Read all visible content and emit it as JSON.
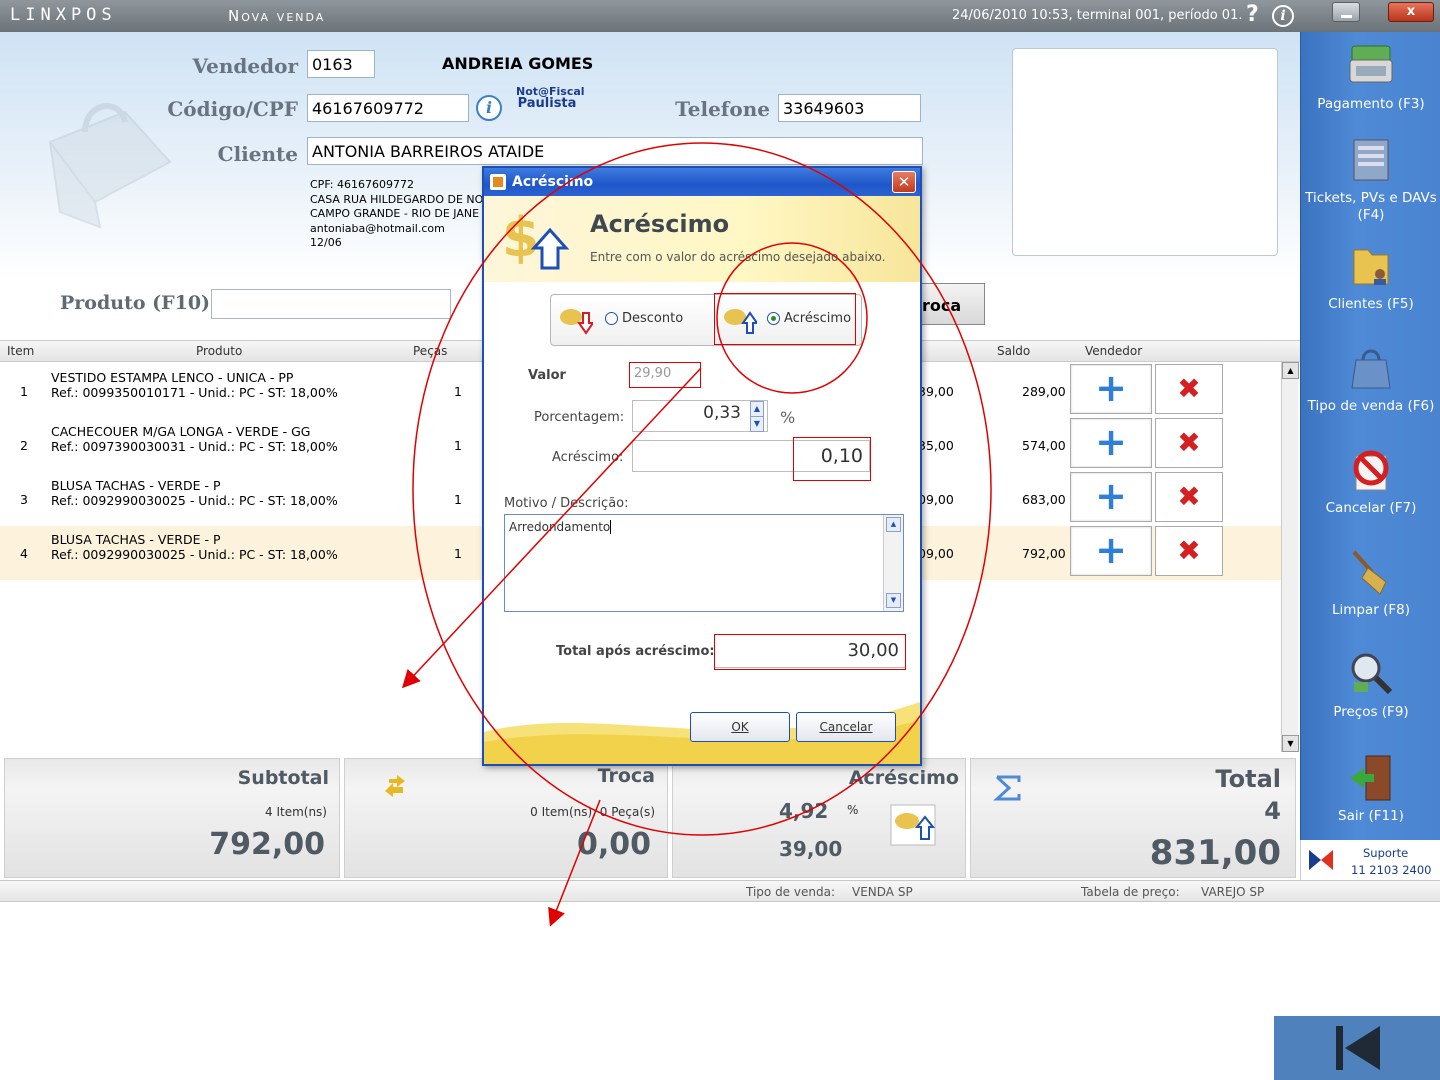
{
  "window": {
    "logo": "LINXPOS",
    "title": "Nova venda",
    "date_info": "24/06/2010 10:53, terminal 001, período 01.",
    "help": "?",
    "info": "i",
    "close": "x"
  },
  "header": {
    "vendedor_label": "Vendedor",
    "vendedor_code": "0163",
    "vendedor_name": "ANDREIA GOMES",
    "codigo_label": "Código/CPF",
    "codigo_value": "46167609772",
    "nota_line1": "Not@Fiscal",
    "nota_line2": "Paulista",
    "telefone_label": "Telefone",
    "telefone_value": "33649603",
    "cliente_label": "Cliente",
    "cliente_value": "ANTONIA BARREIROS ATAIDE",
    "client_details": [
      "CPF: 46167609772",
      "CASA RUA HILDEGARDO DE NO",
      "CAMPO GRANDE - RIO DE JANE",
      "antoniaba@hotmail.com",
      "12/06"
    ]
  },
  "product_bar": {
    "label": "Produto (F10)",
    "troca_label": "roca"
  },
  "table": {
    "headers": {
      "item": "Item",
      "produto": "Produto",
      "pecas": "Peças",
      "saldo": "Saldo",
      "vendedor": "Vendedor"
    },
    "rows": [
      {
        "item": "1",
        "line1": "VESTIDO ESTAMPA LENCO - UNICA - PP",
        "line2": "Ref.: 0099350010171 - Unid.: PC - ST: 18,00%",
        "pecas": "1",
        "total": "39,00",
        "saldo": "289,00"
      },
      {
        "item": "2",
        "line1": "CACHECOUER M/GA LONGA - VERDE - GG",
        "line2": "Ref.: 0097390030031 - Unid.: PC - ST: 18,00%",
        "pecas": "1",
        "total": "35,00",
        "saldo": "574,00"
      },
      {
        "item": "3",
        "line1": "BLUSA TACHAS - VERDE - P",
        "line2": "Ref.: 0092990030025 - Unid.: PC - ST: 18,00%",
        "pecas": "1",
        "total": "09,00",
        "saldo": "683,00"
      },
      {
        "item": "4",
        "line1": "BLUSA TACHAS - VERDE - P",
        "line2": "Ref.: 0092990030025 - Unid.: PC - ST: 18,00%",
        "pecas": "1",
        "total": "09,00",
        "saldo": "792,00"
      }
    ],
    "add_symbol": "+",
    "delete_symbol": "✖"
  },
  "sidebar": {
    "items": [
      {
        "label": "Pagamento (F3)",
        "icon": "payment-icon"
      },
      {
        "label": "Tickets, PVs e DAVs (F4)",
        "icon": "tickets-icon"
      },
      {
        "label": "Clientes (F5)",
        "icon": "clients-folder-icon"
      },
      {
        "label": "Tipo de venda (F6)",
        "icon": "shopping-bag-icon"
      },
      {
        "label": "Cancelar (F7)",
        "icon": "cancel-icon"
      },
      {
        "label": "Limpar (F8)",
        "icon": "broom-icon"
      },
      {
        "label": "Preços (F9)",
        "icon": "magnifier-icon"
      },
      {
        "label": "Sair (F11)",
        "icon": "exit-door-icon"
      }
    ],
    "support_label": "Suporte",
    "support_phone": "11 2103 2400"
  },
  "summary": {
    "subtotal_title": "Subtotal",
    "subtotal_items": "4 Item(ns)",
    "subtotal_value": "792,00",
    "troca_title": "Troca",
    "troca_items": "0 Item(ns), 0 Peça(s)",
    "troca_value": "0,00",
    "acrescimo_title": "Acréscimo",
    "acrescimo_pct": "4,92",
    "acrescimo_pct_sign": "%",
    "acrescimo_value": "39,00",
    "total_title": "Total",
    "total_count": "4",
    "total_value": "831,00"
  },
  "statusbar": {
    "tipo_label": "Tipo de venda:",
    "tipo_value": "VENDA SP",
    "tabela_label": "Tabela de preço:",
    "tabela_value": "VAREJO SP"
  },
  "dialog": {
    "title": "Acréscimo",
    "heading": "Acréscimo",
    "subheading": "Entre com o valor do acréscimo desejado abaixo.",
    "radio_desconto": "Desconto",
    "radio_acrescimo": "Acréscimo",
    "selected": "acrescimo",
    "valor_label": "Valor",
    "valor_value": "29,90",
    "porcentagem_label": "Porcentagem:",
    "porcentagem_value": "0,33",
    "percent_sign": "%",
    "acrescimo_label": "Acréscimo:",
    "acrescimo_value": "0,10",
    "motivo_label": "Motivo / Descrição:",
    "motivo_value": "Arredondamento",
    "total_label": "Total após acréscimo:",
    "total_value": "30,00",
    "ok_label": "OK",
    "cancel_label": "Cancelar"
  },
  "colors": {
    "annotation": "#e00000",
    "sidebar": "#4a84d0",
    "dialog_border": "#1d4fb6",
    "back_nav": "#4f81bd"
  }
}
